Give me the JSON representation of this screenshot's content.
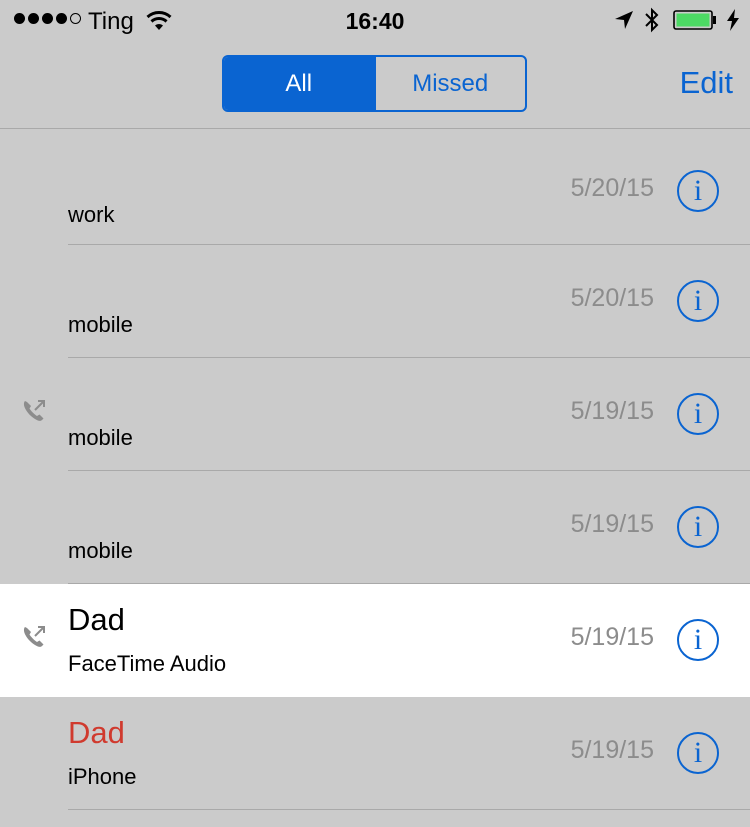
{
  "status": {
    "carrier": "Ting",
    "time": "16:40"
  },
  "nav": {
    "segments": [
      {
        "label": "All",
        "active": true
      },
      {
        "label": "Missed",
        "active": false
      }
    ],
    "edit_label": "Edit"
  },
  "calls": [
    {
      "name": "",
      "subtitle": "work",
      "date": "5/20/15",
      "outgoing": false,
      "missed": false
    },
    {
      "name": "",
      "subtitle": "mobile",
      "date": "5/20/15",
      "outgoing": false,
      "missed": false
    },
    {
      "name": "",
      "subtitle": "mobile",
      "date": "5/19/15",
      "outgoing": true,
      "missed": false
    },
    {
      "name": "",
      "subtitle": "mobile",
      "date": "5/19/15",
      "outgoing": false,
      "missed": false
    },
    {
      "name": "Dad",
      "subtitle": "FaceTime Audio",
      "date": "5/19/15",
      "outgoing": true,
      "missed": false,
      "highlighted": true
    },
    {
      "name": "Dad",
      "subtitle": "iPhone",
      "date": "5/19/15",
      "outgoing": false,
      "missed": true
    }
  ],
  "colors": {
    "accent": "#0a64d1",
    "missed": "#d03a2e",
    "battery": "#4cd964",
    "background": "#cbcbcb"
  },
  "icons": [
    "wifi-icon",
    "location-arrow-icon",
    "bluetooth-icon",
    "battery-icon",
    "charging-bolt-icon",
    "outgoing-call-icon",
    "info-icon"
  ]
}
